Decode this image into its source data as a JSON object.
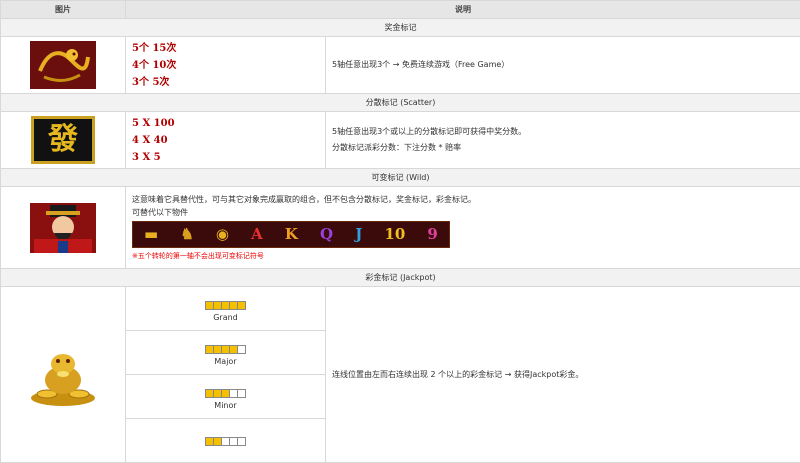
{
  "header": {
    "col_image": "图片",
    "col_desc": "说明"
  },
  "bonus": {
    "title": "奖金标记",
    "pays": [
      "5个 15次",
      "4个 10次",
      "3个 5次"
    ],
    "description": "5轴任意出现3个 → 免费连续游戏（Free Game）",
    "icon": "golden-dragon-icon"
  },
  "scatter": {
    "title": "分散标记 (Scatter)",
    "pays": [
      "5 X 100",
      "4 X 40",
      "3 X 5"
    ],
    "desc_lines": [
      "5轴任意出现3个或以上的分散标记即可获得中奖分数。",
      "分散标记派彩分数：下注分数 * 赔率"
    ],
    "icon": "fa-character-icon",
    "glyph": "發"
  },
  "wild": {
    "title": "可变标记 (Wild)",
    "desc_line1": "这意味着它具替代性，可与其它对象完成赢取的组合，但不包含分散标记，奖金标记，彩金标记。",
    "desc_line2": "可替代以下物件",
    "note": "※五个转轮的第一轴不会出现可变标记符号",
    "icon": "god-of-wealth-icon",
    "symbols": [
      "▬",
      "♞",
      "◉",
      "A",
      "K",
      "Q",
      "J",
      "10",
      "9"
    ]
  },
  "jackpot": {
    "title": "彩金标记 (Jackpot)",
    "levels": [
      "Grand",
      "Major",
      "Minor",
      ""
    ],
    "description": "连线位置由左而右连续出现 2 个以上的彩金标记 → 获得Jackpot彩金。",
    "icon": "golden-toad-coins-icon"
  },
  "colors": {
    "pay_red": "#b00000",
    "header_bg": "#e6e6e6",
    "section_bg": "#f2f2f2",
    "note_red": "#e00000",
    "gold": "#f5c000"
  }
}
